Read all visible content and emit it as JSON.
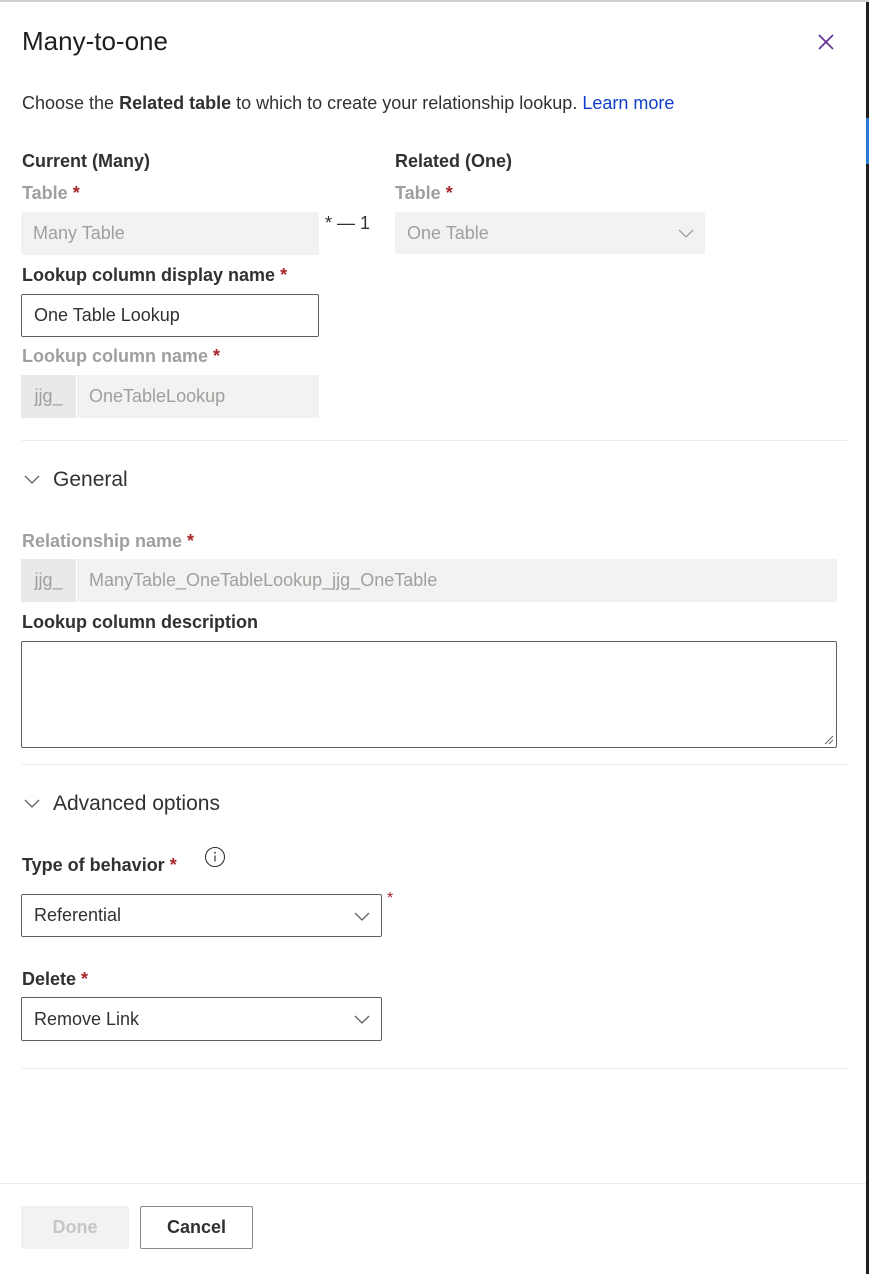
{
  "dialog": {
    "title": "Many-to-one",
    "close_icon": "close-icon",
    "intro": {
      "prefix": "Choose the ",
      "bold": "Related table",
      "suffix": " to which to create your relationship lookup. ",
      "link": "Learn more"
    }
  },
  "current": {
    "heading": "Current (Many)",
    "table_label": "Table",
    "table_value": "Many Table"
  },
  "relation_symbol": "* — 1",
  "related": {
    "heading": "Related (One)",
    "table_label": "Table",
    "table_value": "One Table"
  },
  "lookup": {
    "display_name_label": "Lookup column display name",
    "display_name_value": "One Table Lookup",
    "column_name_label": "Lookup column name",
    "column_name_prefix": "jjg_",
    "column_name_value": "OneTableLookup"
  },
  "general": {
    "section_label": "General",
    "relationship_name_label": "Relationship name",
    "relationship_name_prefix": "jjg_",
    "relationship_name_value": "ManyTable_OneTableLookup_jjg_OneTable",
    "description_label": "Lookup column description",
    "description_value": ""
  },
  "advanced": {
    "section_label": "Advanced options",
    "behavior_label": "Type of behavior",
    "behavior_value": "Referential",
    "delete_label": "Delete",
    "delete_value": "Remove Link"
  },
  "required_mark": "*",
  "footer": {
    "done_label": "Done",
    "cancel_label": "Cancel"
  },
  "colors": {
    "link": "#0f3ec8",
    "required": "#a4262c",
    "close_icon": "#5c2d91"
  }
}
